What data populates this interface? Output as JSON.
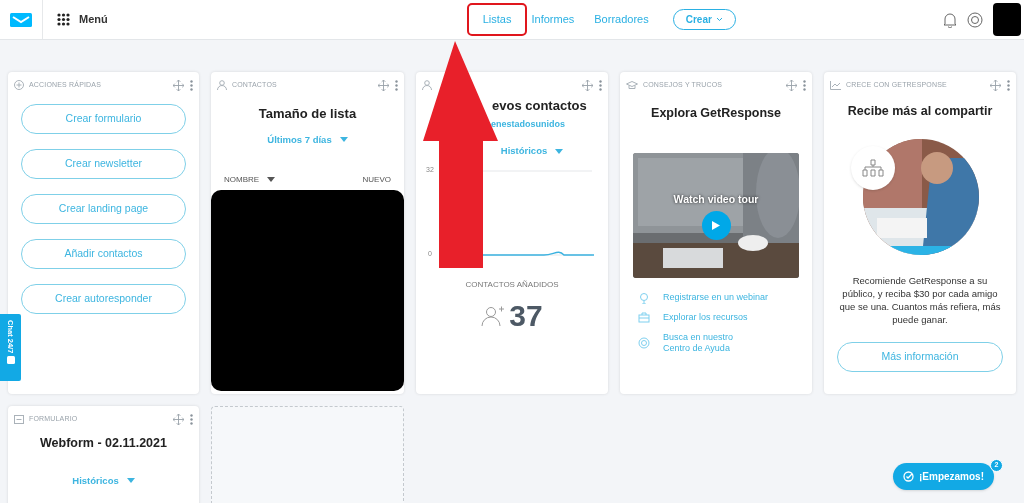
{
  "topbar": {
    "menu_label": "Menú",
    "nav": [
      {
        "label": "Listas",
        "selected": true
      },
      {
        "label": "Informes",
        "selected": false
      },
      {
        "label": "Borradores",
        "selected": false
      }
    ],
    "create_button": "Crear"
  },
  "quick_actions": {
    "header": "ACCIONES RÁPIDAS",
    "buttons": [
      "Crear formulario",
      "Crear newsletter",
      "Crear landing page",
      "Añadir contactos",
      "Crear autoresponder"
    ]
  },
  "contacts": {
    "header": "CONTACTOS",
    "title": "Tamaño de lista",
    "period": "Últimos 7 días",
    "columns": [
      "NOMBRE",
      "NUEVO"
    ]
  },
  "new_contacts": {
    "title": "evos contactos",
    "list": "enestadosunidos",
    "period": "Históricos",
    "y_ticks": [
      "32",
      "0"
    ],
    "added_label": "CONTACTOS AÑADIDOS",
    "added_count": "37"
  },
  "tips": {
    "header": "CONSEJOS Y TRUCOS",
    "title": "Explora GetResponse",
    "video_caption": "Watch video tour",
    "links": [
      {
        "kind": "webinar",
        "label": "Registrarse en un webinar"
      },
      {
        "kind": "resources",
        "label": "Explorar los recursos"
      },
      {
        "kind": "help",
        "label": "Busca en nuestro\nCentro de Ayuda"
      }
    ]
  },
  "grow": {
    "header": "CRECE CON GETRESPONSE",
    "title": "Recibe más al compartir",
    "text": "Recomiende GetResponse a su público, y reciba $30 por cada amigo que se una. Cuantos más refiera, más puede ganar.",
    "button": "Más información"
  },
  "form": {
    "header": "FORMULARIO",
    "title": "Webform - 02.11.2021",
    "period": "Históricos"
  },
  "chat_tab": "Chat 24/7",
  "start_button": {
    "label": "¡Empezamos!",
    "badge": "2"
  }
}
